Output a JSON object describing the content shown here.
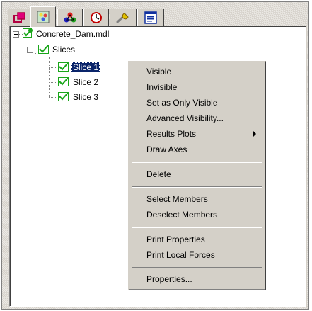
{
  "tabs": [
    {
      "icon": "layers-icon",
      "active": false
    },
    {
      "icon": "palette-icon",
      "active": true
    },
    {
      "icon": "members-icon",
      "active": false
    },
    {
      "icon": "clock-icon",
      "active": false
    },
    {
      "icon": "wrench-icon",
      "active": false
    },
    {
      "icon": "properties-icon",
      "active": false
    }
  ],
  "tree": {
    "root": {
      "label": "Concrete_Dam.mdl"
    },
    "slices_folder": {
      "label": "Slices"
    },
    "slices": [
      {
        "label": "Slice 1",
        "selected": true
      },
      {
        "label": "Slice 2",
        "selected": false
      },
      {
        "label": "Slice 3",
        "selected": false
      }
    ]
  },
  "context_menu": {
    "visible": "Visible",
    "invisible": "Invisible",
    "set_only_visible": "Set as Only Visible",
    "advanced_visibility": "Advanced Visibility...",
    "results_plots": "Results Plots",
    "draw_axes": "Draw Axes",
    "delete": "Delete",
    "select_members": "Select Members",
    "deselect_members": "Deselect Members",
    "print_properties": "Print Properties",
    "print_local_forces": "Print Local Forces",
    "properties": "Properties..."
  },
  "colors": {
    "check_green": "#1aa61a",
    "selection_bg": "#0a246a",
    "face": "#d4d0c8"
  }
}
